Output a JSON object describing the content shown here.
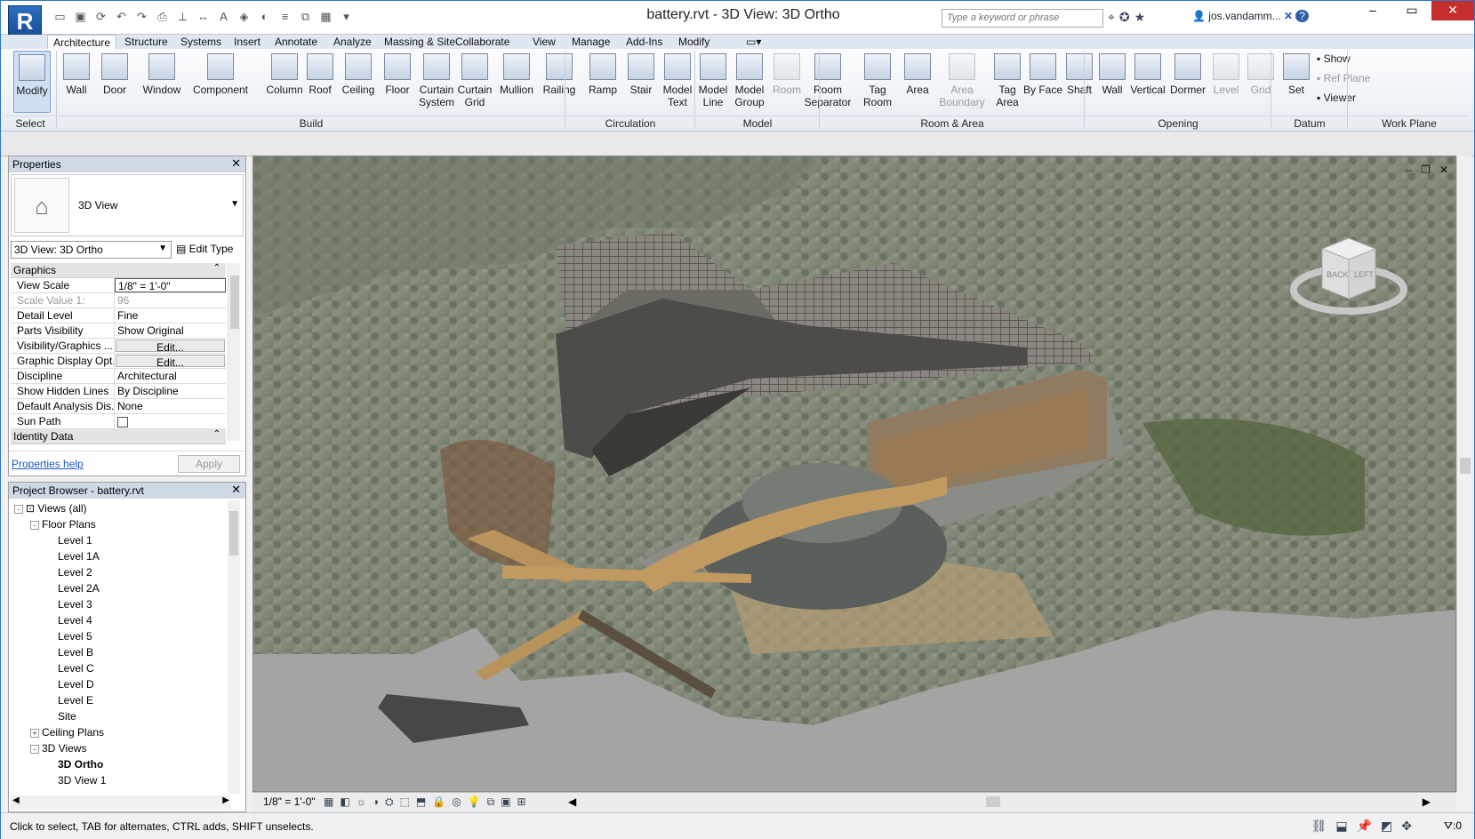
{
  "app": {
    "logo": "R",
    "title": "battery.rvt - 3D View: 3D Ortho"
  },
  "search": {
    "placeholder": "Type a keyword or phrase"
  },
  "user": {
    "name": "jos.vandamm..."
  },
  "tabs": [
    "Architecture",
    "Structure",
    "Systems",
    "Insert",
    "Annotate",
    "Analyze",
    "Massing & Site",
    "Collaborate",
    "View",
    "Manage",
    "Add-Ins",
    "Modify"
  ],
  "ribbon": {
    "buttons": [
      {
        "label": "Modify",
        "name": "modify"
      },
      {
        "label": "Wall",
        "name": "wall"
      },
      {
        "label": "Door",
        "name": "door"
      },
      {
        "label": "Window",
        "name": "window"
      },
      {
        "label": "Component",
        "name": "component"
      },
      {
        "label": "Column",
        "name": "column"
      },
      {
        "label": "Roof",
        "name": "roof"
      },
      {
        "label": "Ceiling",
        "name": "ceiling"
      },
      {
        "label": "Floor",
        "name": "floor"
      },
      {
        "label": "Curtain System",
        "name": "curtain-system"
      },
      {
        "label": "Curtain Grid",
        "name": "curtain-grid"
      },
      {
        "label": "Mullion",
        "name": "mullion"
      },
      {
        "label": "Railing",
        "name": "railing"
      },
      {
        "label": "Ramp",
        "name": "ramp"
      },
      {
        "label": "Stair",
        "name": "stair"
      },
      {
        "label": "Model Text",
        "name": "model-text"
      },
      {
        "label": "Model Line",
        "name": "model-line"
      },
      {
        "label": "Model Group",
        "name": "model-group"
      },
      {
        "label": "Room",
        "name": "room"
      },
      {
        "label": "Room Separator",
        "name": "room-separator"
      },
      {
        "label": "Tag Room",
        "name": "tag-room"
      },
      {
        "label": "Area",
        "name": "area"
      },
      {
        "label": "Area Boundary",
        "name": "area-boundary"
      },
      {
        "label": "Tag Area",
        "name": "tag-area"
      },
      {
        "label": "By Face",
        "name": "by-face"
      },
      {
        "label": "Shaft",
        "name": "shaft"
      },
      {
        "label": "Wall",
        "name": "opening-wall"
      },
      {
        "label": "Vertical",
        "name": "vertical"
      },
      {
        "label": "Dormer",
        "name": "dormer"
      },
      {
        "label": "Level",
        "name": "level"
      },
      {
        "label": "Grid",
        "name": "grid"
      },
      {
        "label": "Set",
        "name": "set"
      },
      {
        "label": "Show",
        "name": "show"
      },
      {
        "label": "Ref Plane",
        "name": "ref-plane"
      },
      {
        "label": "Viewer",
        "name": "viewer"
      }
    ],
    "panels": [
      "Select",
      "Build",
      "Circulation",
      "Model",
      "Room & Area",
      "Opening",
      "Datum",
      "Work Plane"
    ]
  },
  "properties": {
    "title": "Properties",
    "type_name": "3D View",
    "view_selector": "3D View: 3D Ortho",
    "edit_type": "Edit Type",
    "groups": {
      "graphics": "Graphics",
      "identity": "Identity Data"
    },
    "rows": [
      {
        "k": "View Scale",
        "v": "1/8\" = 1'-0\""
      },
      {
        "k": "Scale Value    1:",
        "v": "96"
      },
      {
        "k": "Detail Level",
        "v": "Fine"
      },
      {
        "k": "Parts Visibility",
        "v": "Show Original"
      },
      {
        "k": "Visibility/Graphics ...",
        "v": "Edit..."
      },
      {
        "k": "Graphic Display Opt...",
        "v": "Edit..."
      },
      {
        "k": "Discipline",
        "v": "Architectural"
      },
      {
        "k": "Show Hidden Lines",
        "v": "By Discipline"
      },
      {
        "k": "Default Analysis Dis...",
        "v": "None"
      },
      {
        "k": "Sun Path",
        "v": ""
      }
    ],
    "help": "Properties help",
    "apply": "Apply"
  },
  "browser": {
    "title": "Project Browser - battery.rvt",
    "root": "Views (all)",
    "floor_plans": "Floor Plans",
    "levels": [
      "Level 1",
      "Level 1A",
      "Level 2",
      "Level 2A",
      "Level 3",
      "Level 4",
      "Level 5",
      "Level B",
      "Level C",
      "Level D",
      "Level E",
      "Site"
    ],
    "ceiling_plans": "Ceiling Plans",
    "views_3d": "3D Views",
    "views_3d_items": [
      "3D Ortho",
      "3D View 1"
    ]
  },
  "viewcube": {
    "face1": "BACK",
    "face2": "LEFT"
  },
  "viewbar": {
    "scale": "1/8\" = 1'-0\""
  },
  "status": {
    "text": "Click to select, TAB for alternates, CTRL adds, SHIFT unselects.",
    "filter": ":0"
  }
}
